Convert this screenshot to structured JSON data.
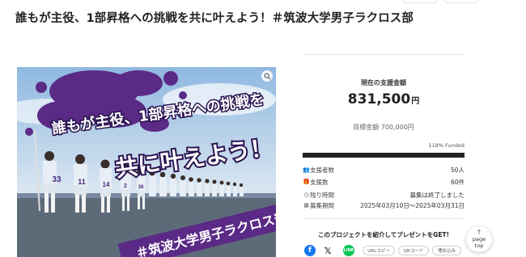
{
  "page": {
    "title": "誰もが主役、1部昇格への挑戦を共に叶えよう！＃筑波大学男子ラクロス部"
  },
  "hero": {
    "text_line1": "誰もが主役、1部昇格への挑戦を",
    "text_line2": "共に叶えよう！",
    "banner": "＃筑波大学男子ラクロス部",
    "jersey_numbers": [
      "33",
      "11",
      "14",
      "2",
      "38"
    ]
  },
  "funding": {
    "current_label": "現在の支援金額",
    "current_amount": "831,500",
    "currency": "円",
    "goal_text": "目標金額 700,000円",
    "funded_text": "118% Funded",
    "funded_percent": 118
  },
  "stats": [
    {
      "icon": "supporters-icon",
      "label": "支援者数",
      "value": "50人"
    },
    {
      "icon": "gift-icon",
      "label": "支援数",
      "value": "60件"
    },
    {
      "icon": "clock-icon",
      "label": "残り時間",
      "value": "募集は終了しました"
    },
    {
      "icon": "calendar-icon",
      "label": "募集期間",
      "value": "2025年03月10日〜2025年03月31日"
    }
  ],
  "share": {
    "title": "このプロジェクトを紹介してプレゼントをGET!",
    "url_copy": "URLコピー",
    "qr_code": "QRコード",
    "embed": "埋め込み",
    "facebook_color": "#1877f2",
    "line_color": "#06c755"
  },
  "pagetop": {
    "line1": "page",
    "line2": "top"
  }
}
